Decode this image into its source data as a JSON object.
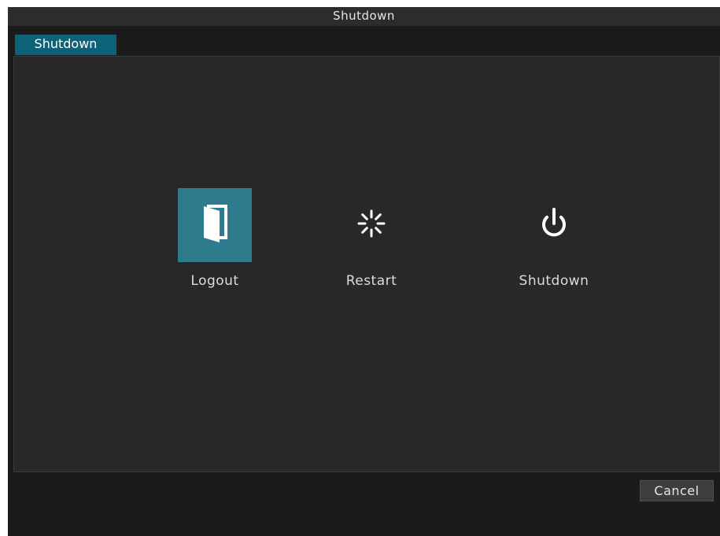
{
  "window": {
    "title": "Shutdown"
  },
  "tabs": [
    {
      "label": "Shutdown",
      "active": true
    }
  ],
  "options": [
    {
      "label": "Logout",
      "icon": "logout-door-icon",
      "selected": true
    },
    {
      "label": "Restart",
      "icon": "restart-spinner-icon",
      "selected": false
    },
    {
      "label": "Shutdown",
      "icon": "power-icon",
      "selected": false
    }
  ],
  "footer": {
    "cancel_label": "Cancel"
  },
  "colors": {
    "accent": "#0d6178",
    "selected_tile": "#2f7b8e",
    "panel_bg": "#282828",
    "dialog_bg": "#1b1b1b"
  }
}
